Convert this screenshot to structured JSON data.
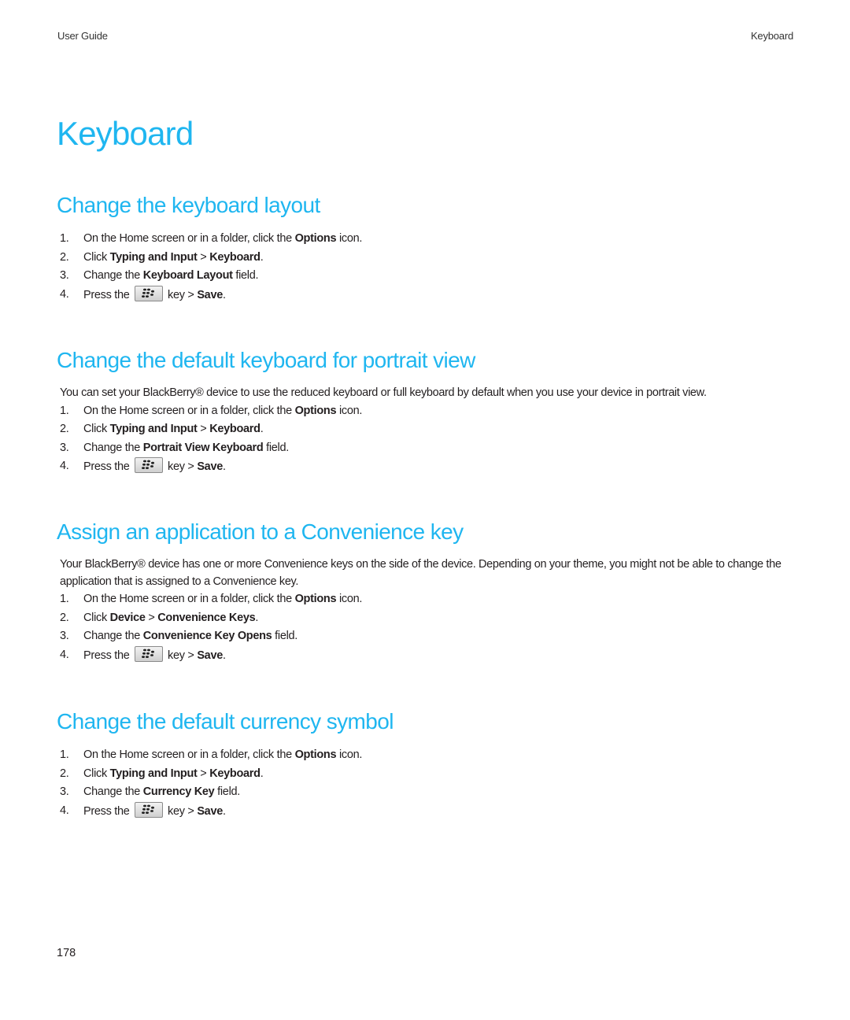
{
  "header": {
    "left": "User Guide",
    "right": "Keyboard"
  },
  "page_title": "Keyboard",
  "key_icon": "blackberry-menu-key-icon",
  "sections": [
    {
      "title": "Change the keyboard layout",
      "intro": "",
      "steps": [
        {
          "num": "1.",
          "parts": [
            "On the Home screen or in a folder, click the ",
            "Options",
            " icon."
          ]
        },
        {
          "num": "2.",
          "parts": [
            "Click ",
            "Typing and Input",
            " > ",
            "Keyboard",
            "."
          ]
        },
        {
          "num": "3.",
          "parts": [
            "Change the ",
            "Keyboard Layout",
            " field."
          ]
        },
        {
          "num": "4.",
          "parts": [
            "Press the ",
            " key > ",
            "Save",
            "."
          ]
        }
      ]
    },
    {
      "title": "Change the default keyboard for portrait view",
      "intro": "You can set your BlackBerry® device to use the reduced keyboard or full keyboard by default when you use your device in portrait view.",
      "steps": [
        {
          "num": "1.",
          "parts": [
            "On the Home screen or in a folder, click the ",
            "Options",
            " icon."
          ]
        },
        {
          "num": "2.",
          "parts": [
            "Click ",
            "Typing and Input",
            " > ",
            "Keyboard",
            "."
          ]
        },
        {
          "num": "3.",
          "parts": [
            "Change the ",
            "Portrait View Keyboard",
            " field."
          ]
        },
        {
          "num": "4.",
          "parts": [
            "Press the ",
            " key > ",
            "Save",
            "."
          ]
        }
      ]
    },
    {
      "title": "Assign an application to a Convenience key",
      "intro": "Your BlackBerry® device has one or more Convenience keys on the side of the device. Depending on your theme, you might not be able to change the application that is assigned to a Convenience key.",
      "steps": [
        {
          "num": "1.",
          "parts": [
            "On the Home screen or in a folder, click the ",
            "Options",
            " icon."
          ]
        },
        {
          "num": "2.",
          "parts": [
            "Click ",
            "Device",
            " > ",
            "Convenience Keys",
            "."
          ]
        },
        {
          "num": "3.",
          "parts": [
            "Change the ",
            "Convenience Key Opens",
            " field."
          ]
        },
        {
          "num": "4.",
          "parts": [
            "Press the ",
            " key > ",
            "Save",
            "."
          ]
        }
      ]
    },
    {
      "title": "Change the default currency symbol",
      "intro": "",
      "steps": [
        {
          "num": "1.",
          "parts": [
            "On the Home screen or in a folder, click the ",
            "Options",
            " icon."
          ]
        },
        {
          "num": "2.",
          "parts": [
            "Click ",
            "Typing and Input",
            " > ",
            "Keyboard",
            "."
          ]
        },
        {
          "num": "3.",
          "parts": [
            "Change the ",
            "Currency Key",
            " field."
          ]
        },
        {
          "num": "4.",
          "parts": [
            "Press the ",
            " key > ",
            "Save",
            "."
          ]
        }
      ]
    }
  ],
  "page_number": "178",
  "colors": {
    "heading": "#1fb6f0",
    "text": "#231f20"
  }
}
